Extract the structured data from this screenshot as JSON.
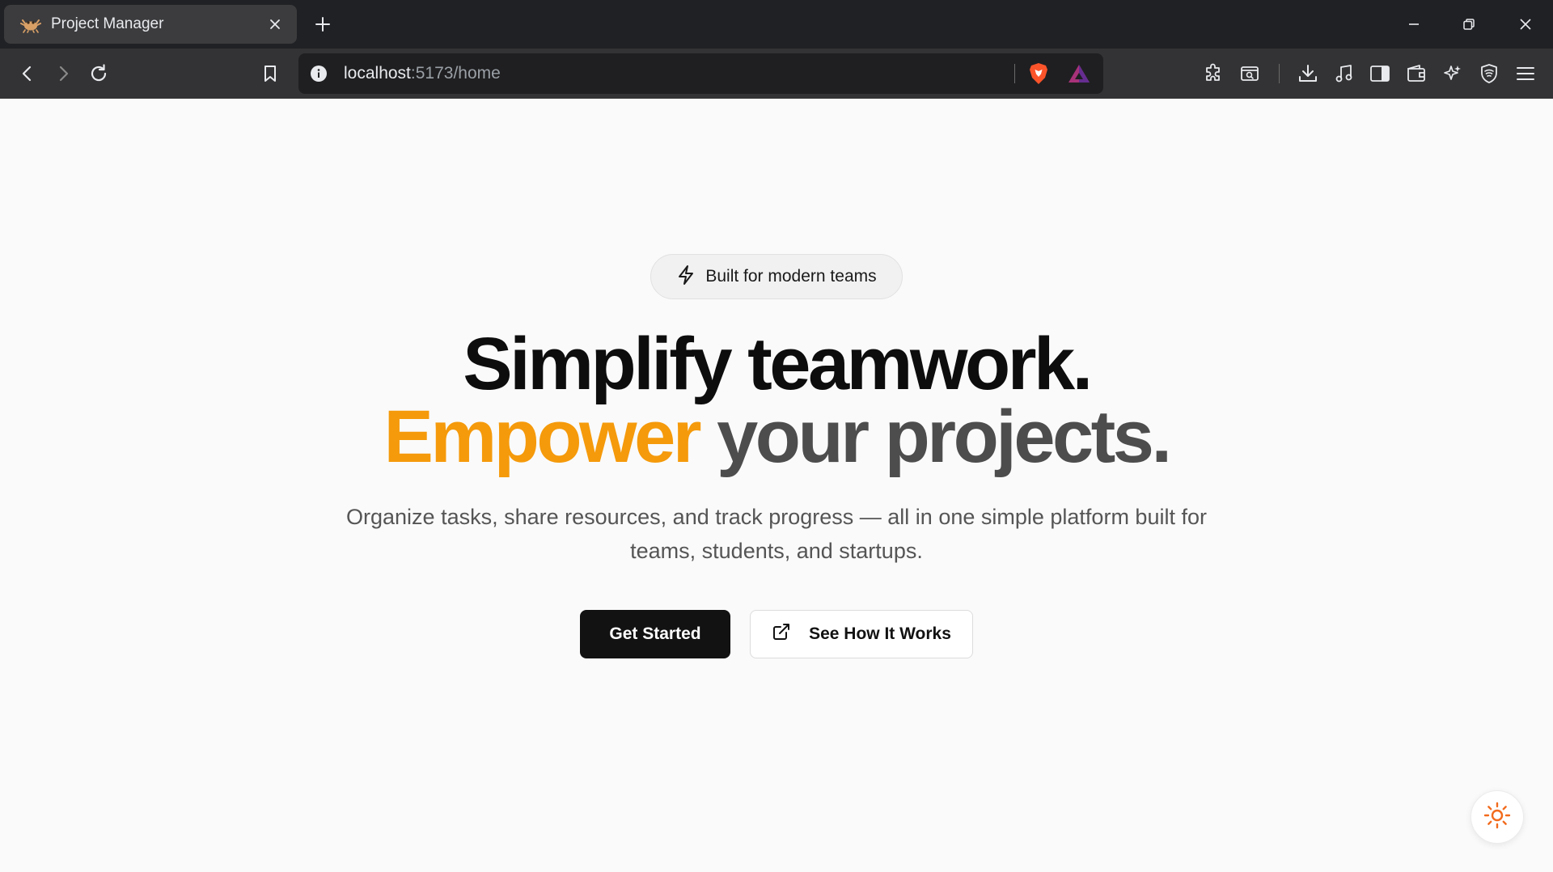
{
  "browser": {
    "tab": {
      "title": "Project Manager",
      "favicon": "crab-icon"
    },
    "url": {
      "host": "localhost",
      "path": ":5173/home"
    },
    "icons": [
      "back-icon",
      "forward-icon",
      "reload-icon",
      "bookmark-icon",
      "site-info-icon",
      "brave-shields-icon",
      "brave-rewards-icon",
      "extensions-icon",
      "screenshot-icon",
      "downloads-icon",
      "media-icon",
      "sidebar-icon",
      "wallet-icon",
      "leo-ai-icon",
      "vpn-icon",
      "menu-icon"
    ]
  },
  "hero": {
    "badge": {
      "icon": "lightning-icon",
      "text": "Built for modern teams"
    },
    "headline_line1": "Simplify teamwork.",
    "headline_accent": "Empower",
    "headline_rest": " your projects.",
    "subtitle": "Organize tasks, share resources, and track progress — all in one simple platform built for teams, students, and startups.",
    "primary_button": "Get Started",
    "secondary_button": "See How It Works"
  },
  "colors": {
    "accent": "#f59a0b",
    "headline": "#0d0d0d",
    "headline_secondary": "#4d4d4d",
    "primary_button_bg": "#121212",
    "page_bg": "#fafafa"
  },
  "theme_toggle": {
    "icon": "sun-icon"
  }
}
